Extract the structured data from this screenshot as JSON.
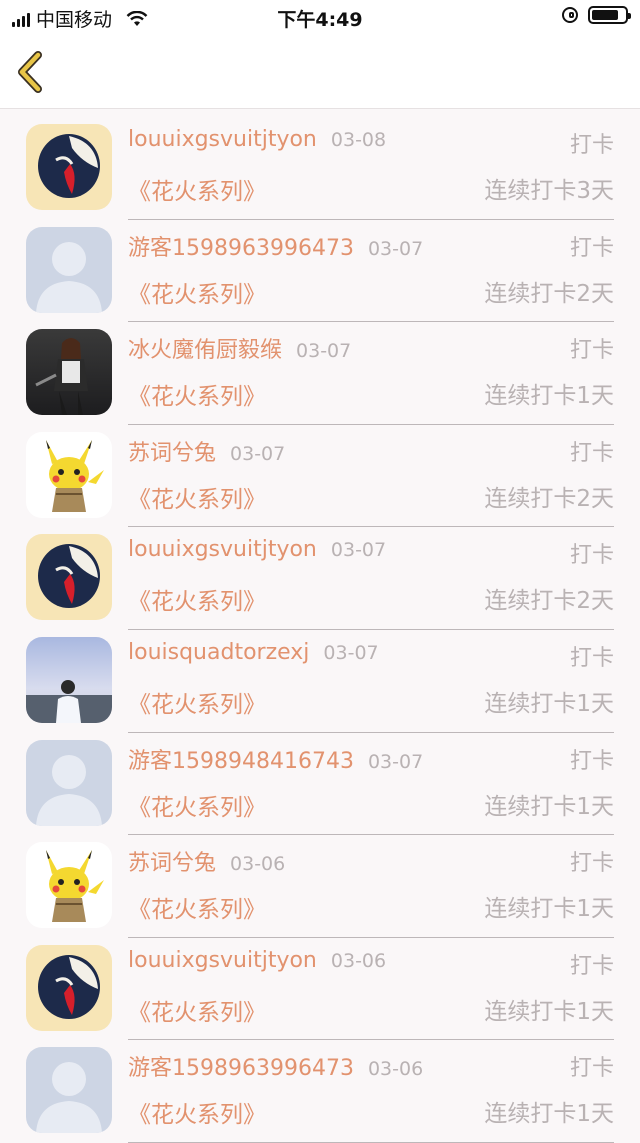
{
  "status_bar": {
    "carrier": "中国移动",
    "time": "下午4:49"
  },
  "nav": {
    "back_icon": "chevron-left-icon",
    "back_color": "#e8c547"
  },
  "colors": {
    "accent": "#e2926e",
    "muted": "#b9b2b3",
    "background": "#faf7f8"
  },
  "records": [
    {
      "avatar": "anime-girl",
      "name": "louuixgsvuitjtyon",
      "date": "03-08",
      "label": "打卡",
      "series": "《花火系列》",
      "streak": "连续打卡3天"
    },
    {
      "avatar": "default",
      "name": "游客1598963996473",
      "date": "03-07",
      "label": "打卡",
      "series": "《花火系列》",
      "streak": "连续打卡2天"
    },
    {
      "avatar": "game-character",
      "name": "冰火魔侑厨毅缑",
      "date": "03-07",
      "label": "打卡",
      "series": "《花火系列》",
      "streak": "连续打卡1天"
    },
    {
      "avatar": "pikachu",
      "name": "苏词兮兔",
      "date": "03-07",
      "label": "打卡",
      "series": "《花火系列》",
      "streak": "连续打卡2天"
    },
    {
      "avatar": "anime-girl",
      "name": "louuixgsvuitjtyon",
      "date": "03-07",
      "label": "打卡",
      "series": "《花火系列》",
      "streak": "连续打卡2天"
    },
    {
      "avatar": "sky-person",
      "name": "louisquadtorzexj",
      "date": "03-07",
      "label": "打卡",
      "series": "《花火系列》",
      "streak": "连续打卡1天"
    },
    {
      "avatar": "default",
      "name": "游客1598948416743",
      "date": "03-07",
      "label": "打卡",
      "series": "《花火系列》",
      "streak": "连续打卡1天"
    },
    {
      "avatar": "pikachu",
      "name": "苏词兮兔",
      "date": "03-06",
      "label": "打卡",
      "series": "《花火系列》",
      "streak": "连续打卡1天"
    },
    {
      "avatar": "anime-girl",
      "name": "louuixgsvuitjtyon",
      "date": "03-06",
      "label": "打卡",
      "series": "《花火系列》",
      "streak": "连续打卡1天"
    },
    {
      "avatar": "default",
      "name": "游客1598963996473",
      "date": "03-06",
      "label": "打卡",
      "series": "《花火系列》",
      "streak": "连续打卡1天"
    }
  ]
}
